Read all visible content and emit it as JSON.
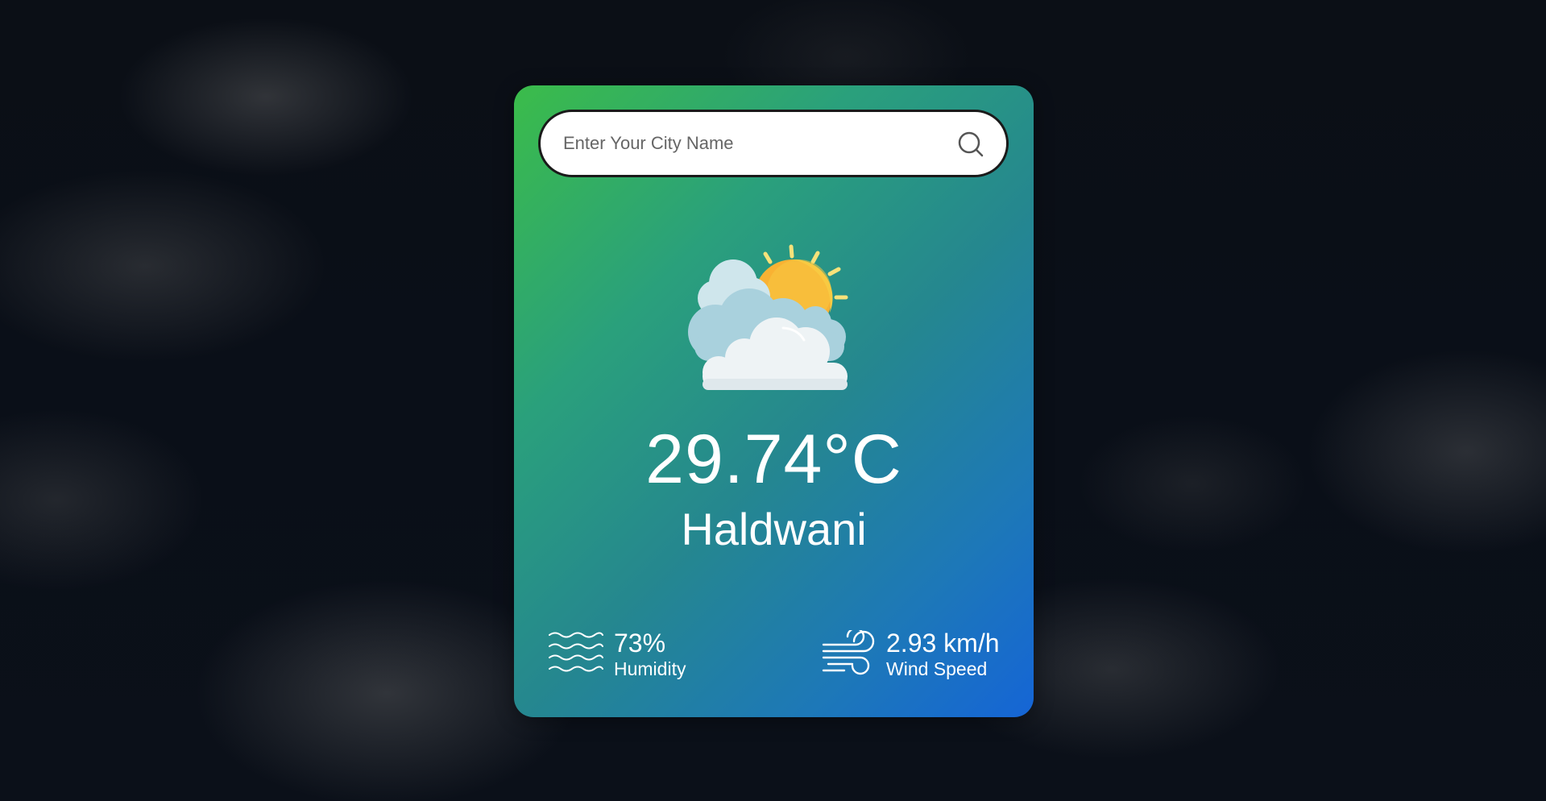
{
  "search": {
    "placeholder": "Enter Your City Name",
    "value": ""
  },
  "weather": {
    "icon": "partly-cloudy-sun-icon",
    "temperature": "29.74°C",
    "city": "Haldwani"
  },
  "humidity": {
    "icon": "humidity-waves-icon",
    "value": "73%",
    "label": "Humidity"
  },
  "wind": {
    "icon": "wind-icon",
    "value": "2.93 km/h",
    "label": "Wind Speed"
  },
  "colors": {
    "card_gradient_start": "#3bbc4a",
    "card_gradient_end": "#1565d6",
    "text": "#ffffff"
  }
}
